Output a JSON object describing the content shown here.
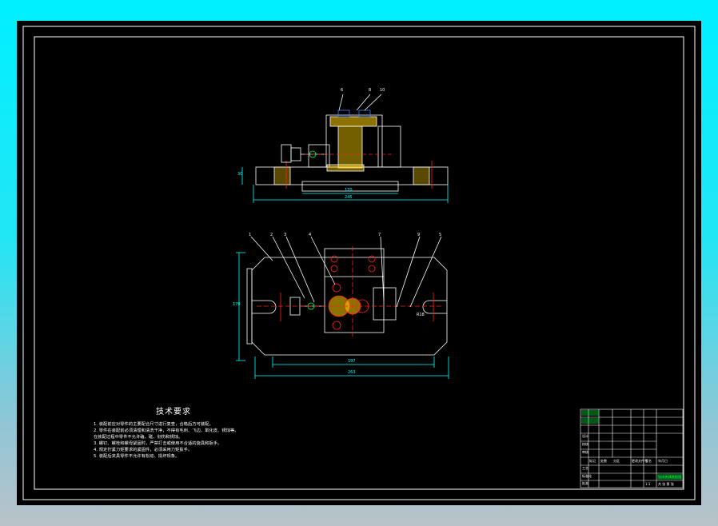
{
  "colors": {
    "background": "#00f0ff",
    "sheet": "#000000",
    "line": "#ffffff",
    "dimension": "#00ffff",
    "hatch": "#ffd000",
    "accent_red": "#ff2020",
    "accent_green": "#00ff40",
    "accent_blue": "#4080ff"
  },
  "front_view": {
    "callouts": [
      "6",
      "8",
      "10"
    ],
    "dims": {
      "height": "30",
      "inner_width": "170",
      "overall_width": "245"
    }
  },
  "top_view": {
    "callouts": [
      "1",
      "2",
      "3",
      "4",
      "7",
      "9",
      "5"
    ],
    "dims": {
      "height": "170",
      "inner_width": "197",
      "overall_width": "263",
      "slot": "R18"
    }
  },
  "technical_requirements": {
    "title": "技术要求",
    "items": [
      "1. 装配前应对零件的主要配合尺寸进行复查，合格后方可装配。",
      "2. 零件在装配前必须清理和清洗干净，不得有毛刺、飞边、氧化皮、锈蚀等。",
      "   在装配过程中零件不允许磕、碰、划伤和锈蚀。",
      "3. 螺钉、螺栓和螺母紧固时，严禁打击或使用不合适的旋具和扳手。",
      "4. 规定拧紧力矩要求的紧固件，必须采用力矩扳手。",
      "5. 装配后夹具零件不允许有松动、损坏现象。"
    ]
  },
  "title_block": {
    "left_labels": [
      "设计",
      "校核",
      "审核",
      "工艺",
      "标准化",
      "批准"
    ],
    "headers": [
      "标记",
      "处数",
      "分区",
      "更改文件号",
      "签名",
      "年月日"
    ],
    "drawing_name": "钻床夹具装配图",
    "scale": "1:1",
    "sheet": "共 张 第 张"
  }
}
